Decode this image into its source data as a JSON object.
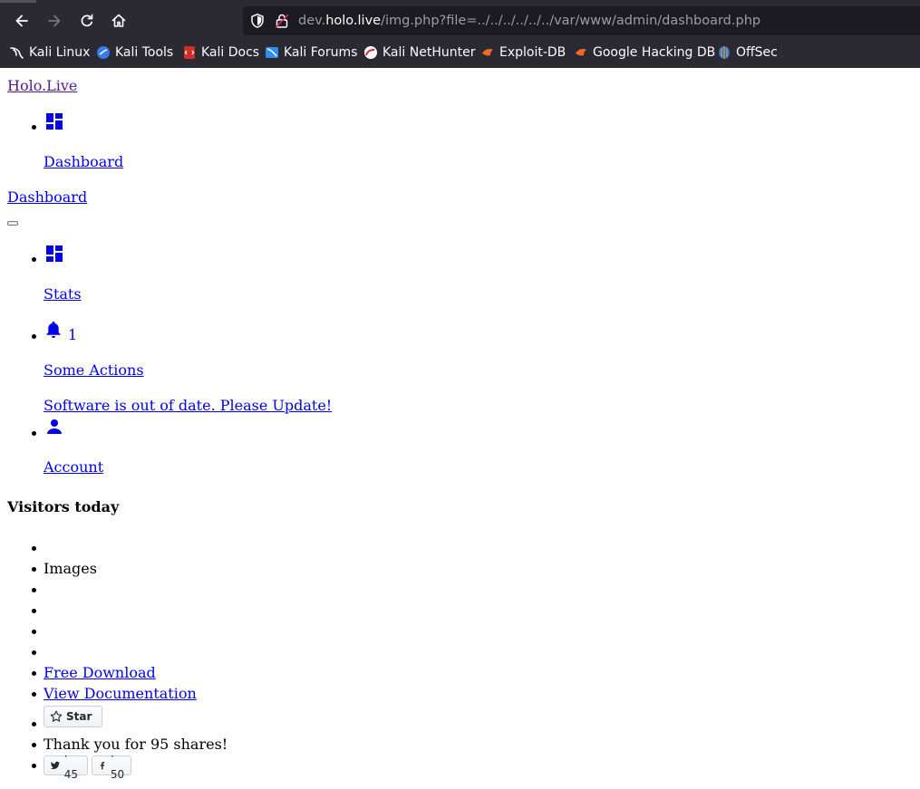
{
  "browser": {
    "url_prefix": "dev.",
    "url_host": "holo.live",
    "url_path": "/img.php?file=../../../../../../var/www/admin/dashboard.php",
    "bookmarks": [
      "Kali Linux",
      "Kali Tools",
      "Kali Docs",
      "Kali Forums",
      "Kali NetHunter",
      "Exploit-DB",
      "Google Hacking DB",
      "OffSec"
    ]
  },
  "brand": "Holo.Live",
  "sidebar": {
    "items": [
      {
        "icon": "dashboard-icon",
        "label": "Dashboard"
      }
    ]
  },
  "navbar": {
    "title": "Dashboard",
    "items": [
      {
        "icon": "dashboard-icon",
        "label": "Stats"
      },
      {
        "icon": "bell-icon",
        "badge": "1",
        "label": "Some Actions",
        "dropdown": "Software is out of date. Please Update!"
      },
      {
        "icon": "person-icon",
        "label": "Account"
      }
    ]
  },
  "main": {
    "heading": "Visitors today",
    "list_item_images": "Images",
    "free_download": "Free Download",
    "view_documentation": "View Documentation",
    "star_label": "Star",
    "thanks_text": "Thank you for 95 shares!",
    "twitter_count": "· 45",
    "facebook_count": "· 50"
  },
  "colors": {
    "link": "#0000ee",
    "visited_link": "#551a8b",
    "chrome_bg": "#2b2a33",
    "urlbar_bg": "#1c1b22"
  }
}
